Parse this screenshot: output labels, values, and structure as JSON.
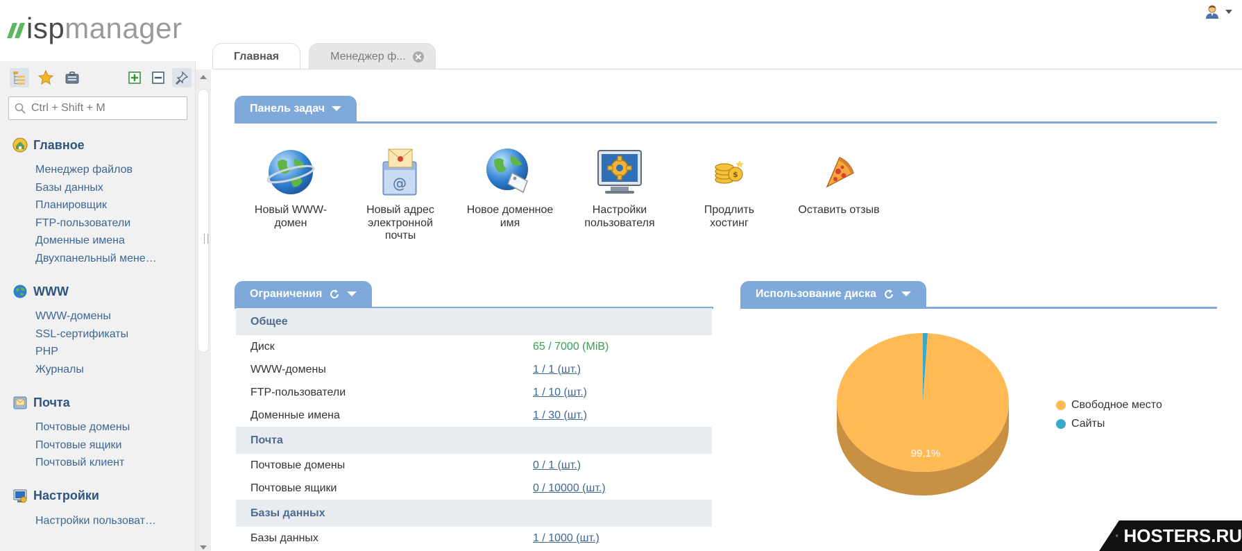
{
  "header": {
    "logo_isp": "isp",
    "logo_manager": "manager",
    "user_icon": "user-icon"
  },
  "sidebar": {
    "tools": [
      {
        "name": "tree-view-icon",
        "active": true
      },
      {
        "name": "favorites-star-icon"
      },
      {
        "name": "briefcase-icon"
      }
    ],
    "tools_right": [
      "expand-all-icon",
      "collapse-all-icon",
      "pin-icon"
    ],
    "search": {
      "placeholder": "Ctrl + Shift + M",
      "value": ""
    },
    "groups": [
      {
        "title": "Главное",
        "icon": "home-icon",
        "items": [
          "Менеджер файлов",
          "Базы данных",
          "Планировщик",
          "FTP-пользователи",
          "Доменные имена",
          "Двухпанельный мене…"
        ]
      },
      {
        "title": "WWW",
        "icon": "globe-icon",
        "items": [
          "WWW-домены",
          "SSL-сертификаты",
          "PHP",
          "Журналы"
        ]
      },
      {
        "title": "Почта",
        "icon": "mail-icon",
        "items": [
          "Почтовые домены",
          "Почтовые ящики",
          "Почтовый клиент"
        ]
      },
      {
        "title": "Настройки",
        "icon": "settings-monitor-icon",
        "items": [
          "Настройки пользоват…"
        ]
      }
    ]
  },
  "tabs": [
    {
      "label": "Главная",
      "active": true
    },
    {
      "label": "Менеджер ф...",
      "active": false,
      "closable": true
    }
  ],
  "task_panel": {
    "title": "Панель задач",
    "tasks": [
      {
        "label": "Новый WWW-домен",
        "icon": "globe-icon"
      },
      {
        "label": "Новый адрес электронной почты",
        "icon": "email-envelope-icon"
      },
      {
        "label": "Новое доменное имя",
        "icon": "globe-tag-icon"
      },
      {
        "label": "Настройки пользователя",
        "icon": "monitor-gear-icon"
      },
      {
        "label": "Продлить хостинг",
        "icon": "coins-icon"
      },
      {
        "label": "Оставить отзыв",
        "icon": "pizza-icon"
      }
    ]
  },
  "limits_panel": {
    "title": "Ограничения",
    "sections": [
      {
        "title": "Общее",
        "rows": [
          {
            "name": "Диск",
            "value": "65 / 7000 (MiB)",
            "style": "green"
          },
          {
            "name": "WWW-домены",
            "value": "1 / 1 (шт.)"
          },
          {
            "name": "FTP-пользователи",
            "value": "1 / 10 (шт.)"
          },
          {
            "name": "Доменные имена",
            "value": "1 / 30 (шт.)"
          }
        ]
      },
      {
        "title": "Почта",
        "rows": [
          {
            "name": "Почтовые домены",
            "value": "0 / 1 (шт.)"
          },
          {
            "name": "Почтовые ящики",
            "value": "0 / 10000 (шт.)"
          }
        ]
      },
      {
        "title": "Базы данных",
        "rows": [
          {
            "name": "Базы данных",
            "value": "1 / 1000 (шт.)"
          }
        ]
      }
    ]
  },
  "disk_panel": {
    "title": "Использование диска",
    "chart_data": {
      "type": "pie",
      "title": "",
      "slices": [
        {
          "label": "Свободное место",
          "value": 99.1,
          "color": "#ffb955",
          "data_label": "99,1%"
        },
        {
          "label": "Сайты",
          "value": 0.9,
          "color": "#3aa8c8"
        }
      ]
    }
  },
  "colors": {
    "accent": "#7fa9d9",
    "nav_link": "#3d6794",
    "ok_green": "#36a24d"
  },
  "watermark": {
    "text": "HOSTERS.RU"
  }
}
